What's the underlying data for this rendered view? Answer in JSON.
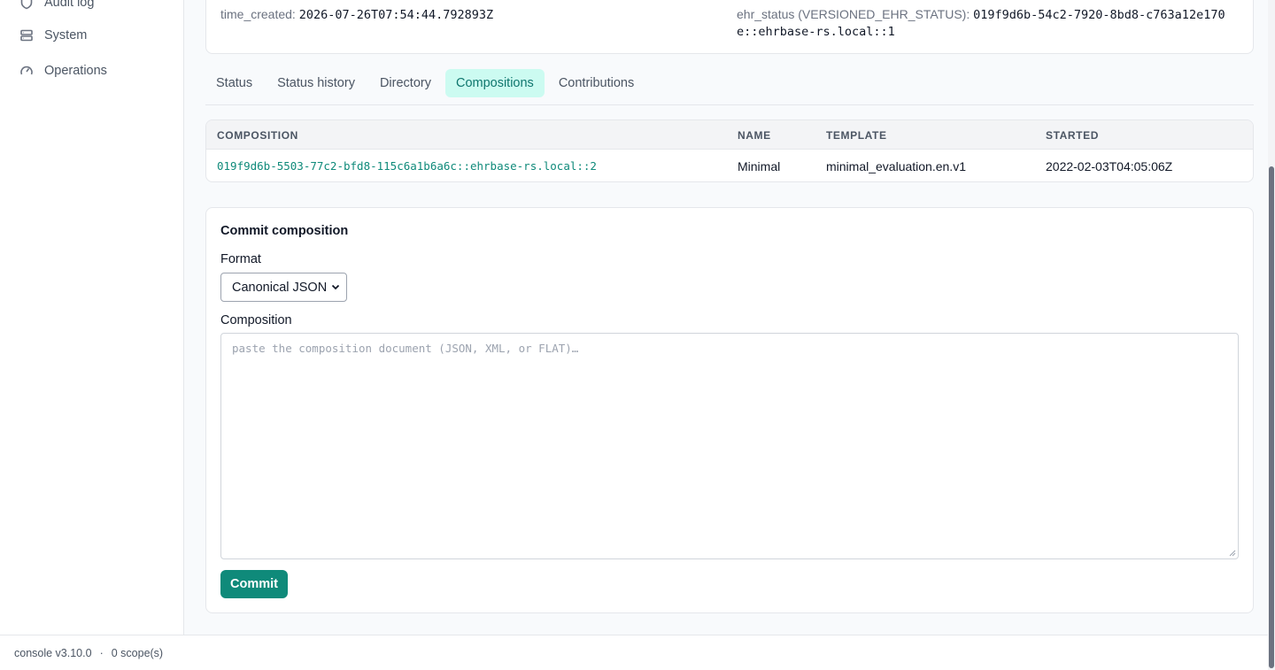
{
  "sidebar": {
    "items": [
      {
        "label": "Audit log",
        "icon": "shield-icon"
      },
      {
        "label": "System",
        "icon": "server-icon"
      },
      {
        "label": "Operations",
        "icon": "gauge-icon"
      }
    ]
  },
  "ehr_meta": {
    "time_created_key": "time_created:",
    "time_created_value": "2026-07-26T07:54:44.792893Z",
    "ehr_status_key": "ehr_status (VERSIONED_EHR_STATUS):",
    "ehr_status_value_line1": "019f9d6b-54c2-7920-8bd8-c763a12e170",
    "ehr_status_value_line2": "e::ehrbase-rs.local::1"
  },
  "tabs": [
    {
      "label": "Status",
      "active": false
    },
    {
      "label": "Status history",
      "active": false
    },
    {
      "label": "Directory",
      "active": false
    },
    {
      "label": "Compositions",
      "active": true
    },
    {
      "label": "Contributions",
      "active": false
    }
  ],
  "compositions_table": {
    "headers": [
      "COMPOSITION",
      "NAME",
      "TEMPLATE",
      "STARTED"
    ],
    "rows": [
      [
        "019f9d6b-5503-77c2-bfd8-115c6a1b6a6c::ehrbase-rs.local::2",
        "Minimal",
        "minimal_evaluation.en.v1",
        "2022-02-03T04:05:06Z"
      ]
    ]
  },
  "commit_form": {
    "title": "Commit composition",
    "format_label": "Format",
    "format_value": "Canonical JSON",
    "composition_label": "Composition",
    "composition_placeholder": "paste the composition document (JSON, XML, or FLAT)…",
    "commit_label": "Commit"
  },
  "footer": {
    "version": "console v3.10.0",
    "separator": "·",
    "scopes": "0 scope(s)"
  },
  "colors": {
    "accent": "#0f8a7a",
    "active_tab_bg": "#ccfbf1"
  }
}
